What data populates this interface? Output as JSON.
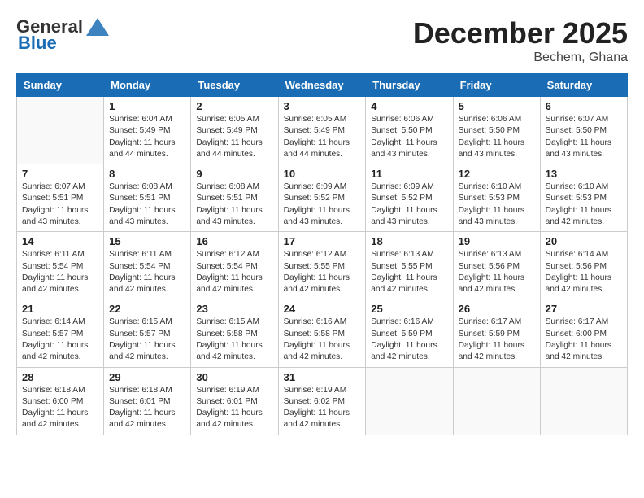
{
  "header": {
    "logo_general": "General",
    "logo_blue": "Blue",
    "month_title": "December 2025",
    "location": "Bechem, Ghana"
  },
  "days_of_week": [
    "Sunday",
    "Monday",
    "Tuesday",
    "Wednesday",
    "Thursday",
    "Friday",
    "Saturday"
  ],
  "weeks": [
    [
      {
        "day": "",
        "sunrise": "",
        "sunset": "",
        "daylight": ""
      },
      {
        "day": "1",
        "sunrise": "Sunrise: 6:04 AM",
        "sunset": "Sunset: 5:49 PM",
        "daylight": "Daylight: 11 hours and 44 minutes."
      },
      {
        "day": "2",
        "sunrise": "Sunrise: 6:05 AM",
        "sunset": "Sunset: 5:49 PM",
        "daylight": "Daylight: 11 hours and 44 minutes."
      },
      {
        "day": "3",
        "sunrise": "Sunrise: 6:05 AM",
        "sunset": "Sunset: 5:49 PM",
        "daylight": "Daylight: 11 hours and 44 minutes."
      },
      {
        "day": "4",
        "sunrise": "Sunrise: 6:06 AM",
        "sunset": "Sunset: 5:50 PM",
        "daylight": "Daylight: 11 hours and 43 minutes."
      },
      {
        "day": "5",
        "sunrise": "Sunrise: 6:06 AM",
        "sunset": "Sunset: 5:50 PM",
        "daylight": "Daylight: 11 hours and 43 minutes."
      },
      {
        "day": "6",
        "sunrise": "Sunrise: 6:07 AM",
        "sunset": "Sunset: 5:50 PM",
        "daylight": "Daylight: 11 hours and 43 minutes."
      }
    ],
    [
      {
        "day": "7",
        "sunrise": "Sunrise: 6:07 AM",
        "sunset": "Sunset: 5:51 PM",
        "daylight": "Daylight: 11 hours and 43 minutes."
      },
      {
        "day": "8",
        "sunrise": "Sunrise: 6:08 AM",
        "sunset": "Sunset: 5:51 PM",
        "daylight": "Daylight: 11 hours and 43 minutes."
      },
      {
        "day": "9",
        "sunrise": "Sunrise: 6:08 AM",
        "sunset": "Sunset: 5:51 PM",
        "daylight": "Daylight: 11 hours and 43 minutes."
      },
      {
        "day": "10",
        "sunrise": "Sunrise: 6:09 AM",
        "sunset": "Sunset: 5:52 PM",
        "daylight": "Daylight: 11 hours and 43 minutes."
      },
      {
        "day": "11",
        "sunrise": "Sunrise: 6:09 AM",
        "sunset": "Sunset: 5:52 PM",
        "daylight": "Daylight: 11 hours and 43 minutes."
      },
      {
        "day": "12",
        "sunrise": "Sunrise: 6:10 AM",
        "sunset": "Sunset: 5:53 PM",
        "daylight": "Daylight: 11 hours and 43 minutes."
      },
      {
        "day": "13",
        "sunrise": "Sunrise: 6:10 AM",
        "sunset": "Sunset: 5:53 PM",
        "daylight": "Daylight: 11 hours and 42 minutes."
      }
    ],
    [
      {
        "day": "14",
        "sunrise": "Sunrise: 6:11 AM",
        "sunset": "Sunset: 5:54 PM",
        "daylight": "Daylight: 11 hours and 42 minutes."
      },
      {
        "day": "15",
        "sunrise": "Sunrise: 6:11 AM",
        "sunset": "Sunset: 5:54 PM",
        "daylight": "Daylight: 11 hours and 42 minutes."
      },
      {
        "day": "16",
        "sunrise": "Sunrise: 6:12 AM",
        "sunset": "Sunset: 5:54 PM",
        "daylight": "Daylight: 11 hours and 42 minutes."
      },
      {
        "day": "17",
        "sunrise": "Sunrise: 6:12 AM",
        "sunset": "Sunset: 5:55 PM",
        "daylight": "Daylight: 11 hours and 42 minutes."
      },
      {
        "day": "18",
        "sunrise": "Sunrise: 6:13 AM",
        "sunset": "Sunset: 5:55 PM",
        "daylight": "Daylight: 11 hours and 42 minutes."
      },
      {
        "day": "19",
        "sunrise": "Sunrise: 6:13 AM",
        "sunset": "Sunset: 5:56 PM",
        "daylight": "Daylight: 11 hours and 42 minutes."
      },
      {
        "day": "20",
        "sunrise": "Sunrise: 6:14 AM",
        "sunset": "Sunset: 5:56 PM",
        "daylight": "Daylight: 11 hours and 42 minutes."
      }
    ],
    [
      {
        "day": "21",
        "sunrise": "Sunrise: 6:14 AM",
        "sunset": "Sunset: 5:57 PM",
        "daylight": "Daylight: 11 hours and 42 minutes."
      },
      {
        "day": "22",
        "sunrise": "Sunrise: 6:15 AM",
        "sunset": "Sunset: 5:57 PM",
        "daylight": "Daylight: 11 hours and 42 minutes."
      },
      {
        "day": "23",
        "sunrise": "Sunrise: 6:15 AM",
        "sunset": "Sunset: 5:58 PM",
        "daylight": "Daylight: 11 hours and 42 minutes."
      },
      {
        "day": "24",
        "sunrise": "Sunrise: 6:16 AM",
        "sunset": "Sunset: 5:58 PM",
        "daylight": "Daylight: 11 hours and 42 minutes."
      },
      {
        "day": "25",
        "sunrise": "Sunrise: 6:16 AM",
        "sunset": "Sunset: 5:59 PM",
        "daylight": "Daylight: 11 hours and 42 minutes."
      },
      {
        "day": "26",
        "sunrise": "Sunrise: 6:17 AM",
        "sunset": "Sunset: 5:59 PM",
        "daylight": "Daylight: 11 hours and 42 minutes."
      },
      {
        "day": "27",
        "sunrise": "Sunrise: 6:17 AM",
        "sunset": "Sunset: 6:00 PM",
        "daylight": "Daylight: 11 hours and 42 minutes."
      }
    ],
    [
      {
        "day": "28",
        "sunrise": "Sunrise: 6:18 AM",
        "sunset": "Sunset: 6:00 PM",
        "daylight": "Daylight: 11 hours and 42 minutes."
      },
      {
        "day": "29",
        "sunrise": "Sunrise: 6:18 AM",
        "sunset": "Sunset: 6:01 PM",
        "daylight": "Daylight: 11 hours and 42 minutes."
      },
      {
        "day": "30",
        "sunrise": "Sunrise: 6:19 AM",
        "sunset": "Sunset: 6:01 PM",
        "daylight": "Daylight: 11 hours and 42 minutes."
      },
      {
        "day": "31",
        "sunrise": "Sunrise: 6:19 AM",
        "sunset": "Sunset: 6:02 PM",
        "daylight": "Daylight: 11 hours and 42 minutes."
      },
      {
        "day": "",
        "sunrise": "",
        "sunset": "",
        "daylight": ""
      },
      {
        "day": "",
        "sunrise": "",
        "sunset": "",
        "daylight": ""
      },
      {
        "day": "",
        "sunrise": "",
        "sunset": "",
        "daylight": ""
      }
    ]
  ]
}
